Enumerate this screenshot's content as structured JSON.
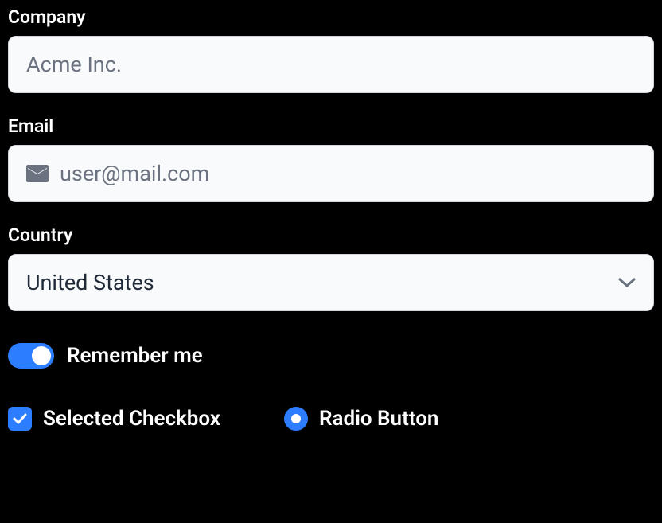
{
  "fields": {
    "company": {
      "label": "Company",
      "placeholder": "Acme Inc.",
      "value": ""
    },
    "email": {
      "label": "Email",
      "placeholder": "user@mail.com",
      "value": ""
    },
    "country": {
      "label": "Country",
      "selected": "United States"
    }
  },
  "toggle": {
    "label": "Remember me",
    "checked": true
  },
  "checkbox": {
    "label": "Selected Checkbox",
    "checked": true
  },
  "radio": {
    "label": "Radio Button",
    "checked": true
  }
}
